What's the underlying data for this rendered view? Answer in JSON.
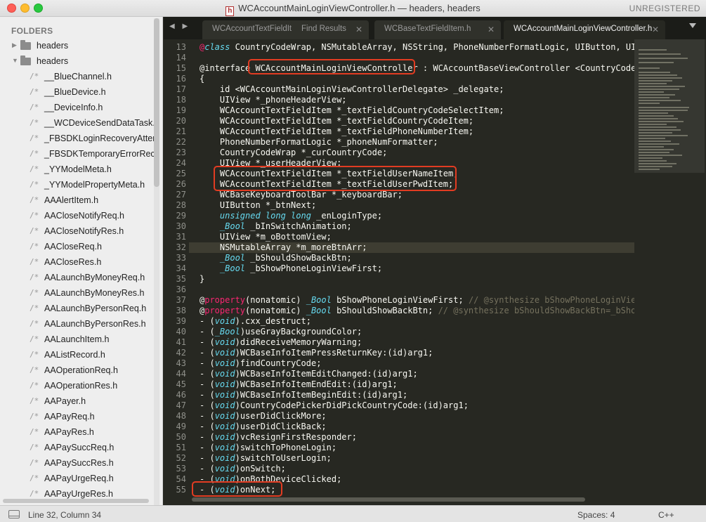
{
  "window": {
    "title": "WCAccountMainLoginViewController.h — headers, headers",
    "file_icon_letter": "h",
    "registration": "UNREGISTERED"
  },
  "sidebar": {
    "header": "FOLDERS",
    "folders": [
      {
        "label": "headers",
        "expanded": false
      },
      {
        "label": "headers",
        "expanded": true
      }
    ],
    "file_prefix": "/*",
    "files": [
      "__BlueChannel.h",
      "__BlueDevice.h",
      "__DeviceInfo.h",
      "__WCDeviceSendDataTask.h",
      "_FBSDKLoginRecoveryAttempter.h",
      "_FBSDKTemporaryErrorRecoveryAttempter.h",
      "_YYModelMeta.h",
      "_YYModelPropertyMeta.h",
      "AAAlertItem.h",
      "AACloseNotifyReq.h",
      "AACloseNotifyRes.h",
      "AACloseReq.h",
      "AACloseRes.h",
      "AALaunchByMoneyReq.h",
      "AALaunchByMoneyRes.h",
      "AALaunchByPersonReq.h",
      "AALaunchByPersonRes.h",
      "AALaunchItem.h",
      "AAListRecord.h",
      "AAOperationReq.h",
      "AAOperationRes.h",
      "AAPayer.h",
      "AAPayReq.h",
      "AAPayRes.h",
      "AAPaySuccReq.h",
      "AAPaySuccRes.h",
      "AAPayUrgeReq.h",
      "AAPayUrgeRes.h"
    ]
  },
  "tabs": [
    {
      "label": "WCAccountTextFieldItem.h",
      "active": false,
      "closable": false
    },
    {
      "label": "Find Results",
      "active": false,
      "closable": true
    },
    {
      "label": "WCBaseTextFieldItem.h",
      "active": false,
      "closable": true
    },
    {
      "label": "WCAccountMainLoginViewController.h",
      "active": true,
      "closable": true
    }
  ],
  "nav_arrows": "◀ ▶",
  "tab_close_glyph": "✕",
  "editor": {
    "current_line": 32,
    "lines": [
      {
        "n": 13,
        "tokens": [
          [
            "@",
            "p"
          ],
          [
            "class",
            "k"
          ],
          [
            " CountryCodeWrap, NSMutableArray, NSString, PhoneNumberFormatLogic, UIButton, UIView;",
            ""
          ]
        ]
      },
      {
        "n": 14,
        "tokens": []
      },
      {
        "n": 15,
        "tokens": [
          [
            "@interface ",
            ""
          ],
          [
            "WCAccountMainLoginViewController",
            ""
          ],
          [
            " : WCAccountBaseViewController <CountryCodePickerViewControllerDelegate>",
            ""
          ]
        ]
      },
      {
        "n": 16,
        "tokens": [
          [
            "{",
            ""
          ]
        ]
      },
      {
        "n": 17,
        "tokens": [
          [
            "    id <WCAccountMainLoginViewControllerDelegate> _delegate;",
            ""
          ]
        ]
      },
      {
        "n": 18,
        "tokens": [
          [
            "    UIView *_phoneHeaderView;",
            ""
          ]
        ]
      },
      {
        "n": 19,
        "tokens": [
          [
            "    WCAccountTextFieldItem *_textFieldCountryCodeSelectItem;",
            ""
          ]
        ]
      },
      {
        "n": 20,
        "tokens": [
          [
            "    WCAccountTextFieldItem *_textFieldCountryCodeItem;",
            ""
          ]
        ]
      },
      {
        "n": 21,
        "tokens": [
          [
            "    WCAccountTextFieldItem *_textFieldPhoneNumberItem;",
            ""
          ]
        ]
      },
      {
        "n": 22,
        "tokens": [
          [
            "    PhoneNumberFormatLogic *_phoneNumFormatter;",
            ""
          ]
        ]
      },
      {
        "n": 23,
        "tokens": [
          [
            "    CountryCodeWrap *_curCountryCode;",
            ""
          ]
        ]
      },
      {
        "n": 24,
        "tokens": [
          [
            "    UIView *_userHeaderView;",
            ""
          ]
        ]
      },
      {
        "n": 25,
        "tokens": [
          [
            "    WCAccountTextFieldItem *_textFieldUserNameItem;",
            ""
          ]
        ]
      },
      {
        "n": 26,
        "tokens": [
          [
            "    WCAccountTextFieldItem *_textFieldUserPwdItem;",
            ""
          ]
        ]
      },
      {
        "n": 27,
        "tokens": [
          [
            "    WCBaseKeyboardToolBar *_keyboardBar;",
            ""
          ]
        ]
      },
      {
        "n": 28,
        "tokens": [
          [
            "    UIButton *_btnNext;",
            ""
          ]
        ]
      },
      {
        "n": 29,
        "tokens": [
          [
            "    ",
            ""
          ],
          [
            "unsigned long long",
            "t"
          ],
          [
            " _enLoginType;",
            ""
          ]
        ]
      },
      {
        "n": 30,
        "tokens": [
          [
            "    ",
            ""
          ],
          [
            "_Bool",
            "t"
          ],
          [
            " _bInSwitchAnimation;",
            ""
          ]
        ]
      },
      {
        "n": 31,
        "tokens": [
          [
            "    UIView *m_oBottomView;",
            ""
          ]
        ]
      },
      {
        "n": 32,
        "tokens": [
          [
            "    NSMutableArray *m_moreBtnArr;",
            ""
          ]
        ]
      },
      {
        "n": 33,
        "tokens": [
          [
            "    ",
            ""
          ],
          [
            "_Bool",
            "t"
          ],
          [
            " _bShouldShowBackBtn;",
            ""
          ]
        ]
      },
      {
        "n": 34,
        "tokens": [
          [
            "    ",
            ""
          ],
          [
            "_Bool",
            "t"
          ],
          [
            " _bShowPhoneLoginViewFirst;",
            ""
          ]
        ]
      },
      {
        "n": 35,
        "tokens": [
          [
            "}",
            ""
          ]
        ]
      },
      {
        "n": 36,
        "tokens": []
      },
      {
        "n": 37,
        "tokens": [
          [
            "@",
            ""
          ],
          [
            "property",
            "p"
          ],
          [
            "(nonatomic) ",
            ""
          ],
          [
            "_Bool",
            "t"
          ],
          [
            " bShowPhoneLoginViewFirst; ",
            ""
          ],
          [
            "// @synthesize bShowPhoneLoginViewFirst=_bShowPhoneLoginViewFirst;",
            "c"
          ]
        ]
      },
      {
        "n": 38,
        "tokens": [
          [
            "@",
            ""
          ],
          [
            "property",
            "p"
          ],
          [
            "(nonatomic) ",
            ""
          ],
          [
            "_Bool",
            "t"
          ],
          [
            " bShouldShowBackBtn; ",
            ""
          ],
          [
            "// @synthesize bShouldShowBackBtn=_bShouldShowBackBtn;",
            "c"
          ]
        ]
      },
      {
        "n": 39,
        "tokens": [
          [
            "- (",
            ""
          ],
          [
            "void",
            "t"
          ],
          [
            ").cxx_destruct;",
            ""
          ]
        ]
      },
      {
        "n": 40,
        "tokens": [
          [
            "- (",
            ""
          ],
          [
            "_Bool",
            "t"
          ],
          [
            ")useGrayBackgroundColor;",
            ""
          ]
        ]
      },
      {
        "n": 41,
        "tokens": [
          [
            "- (",
            ""
          ],
          [
            "void",
            "t"
          ],
          [
            ")didReceiveMemoryWarning;",
            ""
          ]
        ]
      },
      {
        "n": 42,
        "tokens": [
          [
            "- (",
            ""
          ],
          [
            "void",
            "t"
          ],
          [
            ")WCBaseInfoItemPressReturnKey:(id)arg1;",
            ""
          ]
        ]
      },
      {
        "n": 43,
        "tokens": [
          [
            "- (",
            ""
          ],
          [
            "void",
            "t"
          ],
          [
            ")findCountryCode;",
            ""
          ]
        ]
      },
      {
        "n": 44,
        "tokens": [
          [
            "- (",
            ""
          ],
          [
            "void",
            "t"
          ],
          [
            ")WCBaseInfoItemEditChanged:(id)arg1;",
            ""
          ]
        ]
      },
      {
        "n": 45,
        "tokens": [
          [
            "- (",
            ""
          ],
          [
            "void",
            "t"
          ],
          [
            ")WCBaseInfoItemEndEdit:(id)arg1;",
            ""
          ]
        ]
      },
      {
        "n": 46,
        "tokens": [
          [
            "- (",
            ""
          ],
          [
            "void",
            "t"
          ],
          [
            ")WCBaseInfoItemBeginEdit:(id)arg1;",
            ""
          ]
        ]
      },
      {
        "n": 47,
        "tokens": [
          [
            "- (",
            ""
          ],
          [
            "void",
            "t"
          ],
          [
            ")CountryCodePickerDidPickCountryCode:(id)arg1;",
            ""
          ]
        ]
      },
      {
        "n": 48,
        "tokens": [
          [
            "- (",
            ""
          ],
          [
            "void",
            "t"
          ],
          [
            ")userDidClickMore;",
            ""
          ]
        ]
      },
      {
        "n": 49,
        "tokens": [
          [
            "- (",
            ""
          ],
          [
            "void",
            "t"
          ],
          [
            ")userDidClickBack;",
            ""
          ]
        ]
      },
      {
        "n": 50,
        "tokens": [
          [
            "- (",
            ""
          ],
          [
            "void",
            "t"
          ],
          [
            ")vcResignFirstResponder;",
            ""
          ]
        ]
      },
      {
        "n": 51,
        "tokens": [
          [
            "- (",
            ""
          ],
          [
            "void",
            "t"
          ],
          [
            ")switchToPhoneLogin;",
            ""
          ]
        ]
      },
      {
        "n": 52,
        "tokens": [
          [
            "- (",
            ""
          ],
          [
            "void",
            "t"
          ],
          [
            ")switchToUserLogin;",
            ""
          ]
        ]
      },
      {
        "n": 53,
        "tokens": [
          [
            "- (",
            ""
          ],
          [
            "void",
            "t"
          ],
          [
            ")onSwitch;",
            ""
          ]
        ]
      },
      {
        "n": 54,
        "tokens": [
          [
            "- (",
            ""
          ],
          [
            "void",
            "t"
          ],
          [
            ")onBothDeviceClicked;",
            ""
          ]
        ]
      },
      {
        "n": 55,
        "tokens": [
          [
            "- (",
            ""
          ],
          [
            "void",
            "t"
          ],
          [
            ")onNext;",
            ""
          ]
        ]
      }
    ]
  },
  "statusbar": {
    "position": "Line 32, Column 34",
    "indentation": "Spaces: 4",
    "syntax": "C++"
  },
  "colors": {
    "editor_bg": "#272822",
    "keyword_blue": "#66d9ef",
    "keyword_pink": "#f92672",
    "comment": "#75715e",
    "highlight_box": "#e23c22"
  }
}
